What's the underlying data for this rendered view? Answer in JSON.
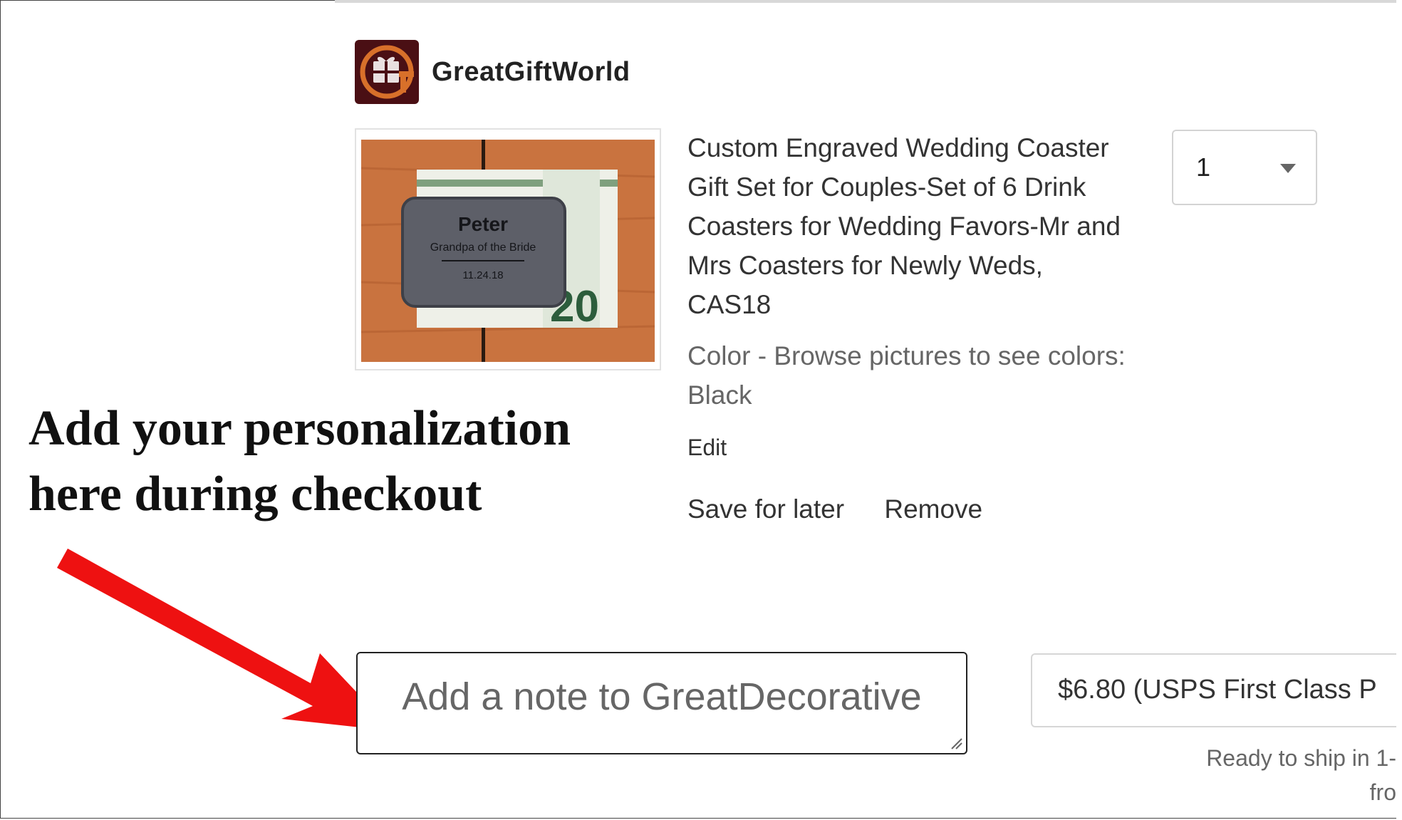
{
  "shop": {
    "name": "GreatGiftWorld",
    "logo_icon": "gift-box-g-logo"
  },
  "product": {
    "title": "Custom Engraved Wedding Coaster Gift Set for Couples-Set of 6 Drink Coasters for Wedding Favors-Mr and Mrs Coasters for Newly Weds, CAS18",
    "variation": "Color - Browse pictures to see colors: Black",
    "image": {
      "engraved_name": "Peter",
      "engraved_subtitle": "Grandpa of the Bride",
      "engraved_date": "11.24.18",
      "bill_denomination": "20"
    },
    "edit_label": "Edit",
    "save_for_later_label": "Save for later",
    "remove_label": "Remove",
    "quantity": "1"
  },
  "annotation": {
    "line1": "Add your personalization",
    "line2": "here during checkout",
    "arrow_color": "#ee1111"
  },
  "note": {
    "placeholder": "Add a note to GreatDecorative"
  },
  "shipping": {
    "option_label": "$6.80 (USPS First Class P",
    "ready_line1": "Ready to ship in 1-",
    "ready_line2": "fro"
  }
}
